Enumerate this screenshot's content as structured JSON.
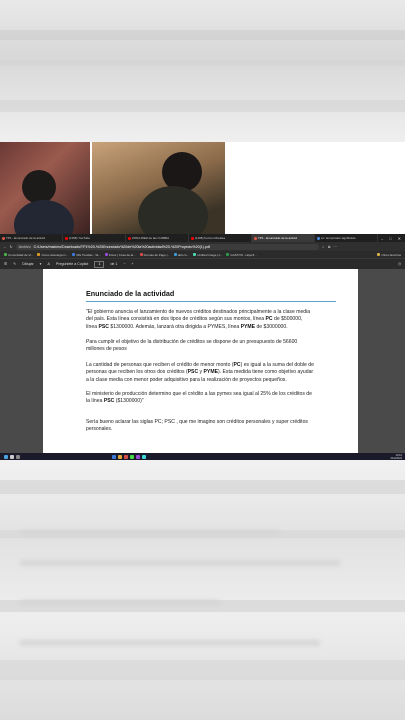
{
  "browser_tabs": [
    {
      "label": "TP1 - Enunciado de la activid",
      "color": "#e05a4a",
      "active": false
    },
    {
      "label": "(1198) YouTube",
      "color": "#ff0000",
      "active": false
    },
    {
      "label": "ZONA DIEZ de las CUMBIA",
      "color": "#ff0000",
      "active": false
    },
    {
      "label": "(1198) Ferzon Morales",
      "color": "#ff0000",
      "active": false
    },
    {
      "label": "TP1 - Enunciado de la activid",
      "color": "#e05a4a",
      "active": true
    },
    {
      "label": "ex: temporales significado",
      "color": "#4a8fe0",
      "active": false
    }
  ],
  "address": {
    "prefix": "Archivo",
    "url": "C:/Users/maximo/Downloads/TP1%20-%20Enunciado%20de%20la%20actividad%20-%20Proyecto%20(1).pdf"
  },
  "bookmarks": [
    {
      "label": "Comunidad de Vi...",
      "color": "#4ab04a"
    },
    {
      "label": "Curso descarga m...",
      "color": "#e09a2a"
    },
    {
      "label": "Mis Tiendas - Ta...",
      "color": "#3a7ad9"
    },
    {
      "label": "Fotos | Cosa de la...",
      "color": "#9a4ad9"
    },
    {
      "label": "Formas de Pago |...",
      "color": "#d94a4a"
    },
    {
      "label": "ablo G...",
      "color": "#3a9ad9"
    },
    {
      "label": "Untitled image (1...",
      "color": "#4ad9b0"
    },
    {
      "label": "GASTOS - Hoja 8...",
      "color": "#2a9a4a"
    },
    {
      "label": "Otros favoritos",
      "color": "#d9b04a"
    }
  ],
  "pdf_toolbar": {
    "draw_label": "Dibujar",
    "read_aloud_label": "Pregúntele a Copilot",
    "page_current": "1",
    "page_total": "de 1"
  },
  "document": {
    "title": "Enunciado de la actividad",
    "paragraphs": [
      {
        "parts": [
          {
            "text": "\"El gobierno anuncia el lanzamiento de nuevos créditos destinados principalmente a la clase media del país. Esta línea consistirá en dos tipos de créditos según sus montos, línea "
          },
          {
            "text": "PC",
            "bold": true
          },
          {
            "text": " de $500000, línea "
          },
          {
            "text": "PSC",
            "bold": true
          },
          {
            "text": " $1300000. Además, lanzará otra dirigida a PYMES, línea "
          },
          {
            "text": "PYME",
            "bold": true
          },
          {
            "text": " de $3000000."
          }
        ]
      },
      {
        "parts": [
          {
            "text": "Para cumplir el objetivo de la distribución de créditos se dispone de un presupuesto de 56600 millones de pesos"
          }
        ]
      },
      {
        "parts": [
          {
            "text": "La cantidad de personas que reciben el crédito de menor monto ("
          },
          {
            "text": "PC",
            "bold": true
          },
          {
            "text": ") es igual a la suma del doble de personas que reciben los otros dos créditos ("
          },
          {
            "text": "PSC",
            "bold": true
          },
          {
            "text": " y "
          },
          {
            "text": "PYME",
            "bold": true
          },
          {
            "text": "). Esta medida tiene como objetivo ayudar a la clase media con menor poder adquisitivo para la realización de proyectos pequeños."
          }
        ]
      },
      {
        "parts": [
          {
            "text": "El ministerio de producción determino que el crédito a las pymes sea igual al 25% de los créditos de la línea "
          },
          {
            "text": "PSC",
            "bold": true
          },
          {
            "text": " ($1300000)\""
          }
        ]
      },
      {
        "parts": [
          {
            "text": "Sería bueno aclarar las siglas PC; PSC , que me imagino son créditos personales y super créditos personales."
          }
        ]
      }
    ]
  },
  "taskbar": {
    "time": "10:12",
    "date": "21/4/2024"
  }
}
